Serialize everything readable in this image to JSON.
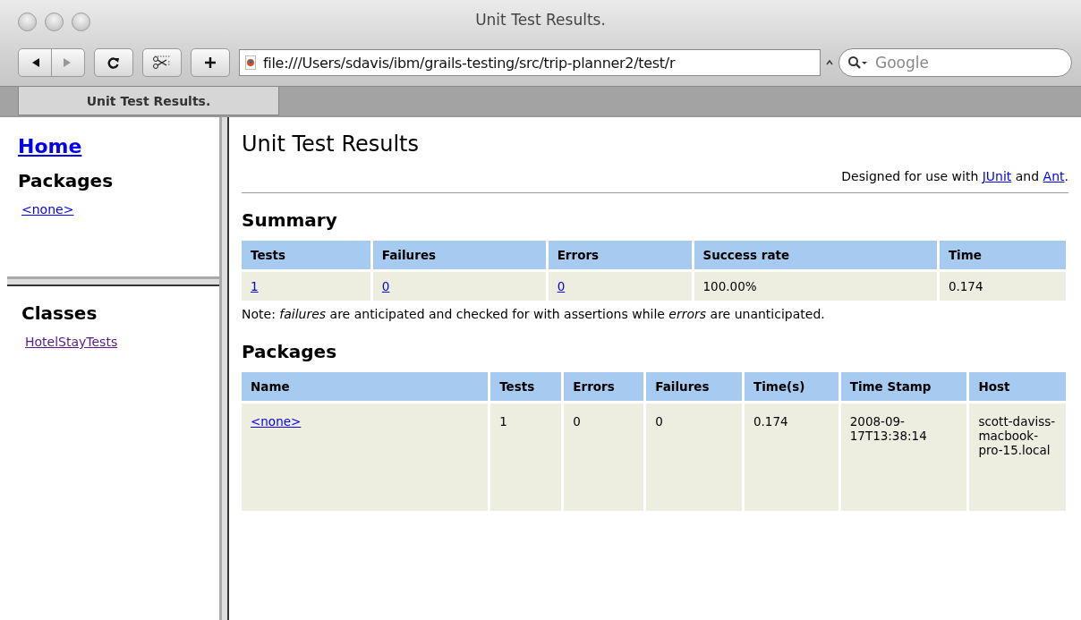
{
  "window": {
    "title": "Unit Test Results."
  },
  "toolbar": {
    "url": "file:///Users/sdavis/ibm/grails-testing/src/trip-planner2/test/r",
    "search": {
      "placeholder": "Google"
    }
  },
  "tabs": [
    {
      "label": "Unit Test Results.",
      "selected": true
    }
  ],
  "sidebar": {
    "home": "Home",
    "packages_heading": "Packages",
    "packages": [
      {
        "label": "<none>",
        "visited": false
      }
    ],
    "classes_heading": "Classes",
    "classes": [
      {
        "label": "HotelStayTests",
        "visited": true
      }
    ]
  },
  "main": {
    "title": "Unit Test Results",
    "credit_parts": [
      {
        "text": "Designed for use with ",
        "link": false
      },
      {
        "text": "JUnit",
        "link": true
      },
      {
        "text": " and ",
        "link": false
      },
      {
        "text": "Ant",
        "link": true
      },
      {
        "text": ".",
        "link": false
      }
    ],
    "summary": {
      "heading": "Summary",
      "columns": [
        "Tests",
        "Failures",
        "Errors",
        "Success rate",
        "Time"
      ],
      "row": [
        {
          "text": "1",
          "link": true
        },
        {
          "text": "0",
          "link": true
        },
        {
          "text": "0",
          "link": true
        },
        {
          "text": "100.00%",
          "link": false
        },
        {
          "text": "0.174",
          "link": false
        }
      ],
      "note": "Note: *failures* are anticipated and checked for with assertions while *errors* are unanticipated."
    },
    "packages": {
      "heading": "Packages",
      "columns": [
        "Name",
        "Tests",
        "Errors",
        "Failures",
        "Time(s)",
        "Time Stamp",
        "Host"
      ],
      "rows": [
        [
          {
            "text": "<none>",
            "link": true
          },
          {
            "text": "1",
            "link": false
          },
          {
            "text": "0",
            "link": false
          },
          {
            "text": "0",
            "link": false
          },
          {
            "text": "0.174",
            "link": false
          },
          {
            "text": "2008-09-17T13:38:14",
            "link": false
          },
          {
            "text": "scott-daviss-macbook-pro-15.local",
            "link": false
          }
        ]
      ]
    }
  }
}
